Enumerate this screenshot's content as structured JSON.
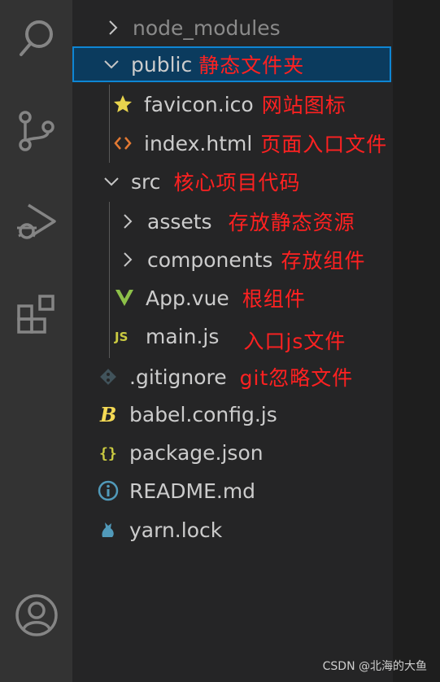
{
  "explorer": {
    "items": [
      {
        "name": "node_modules",
        "type": "folder",
        "expanded": false,
        "note": ""
      },
      {
        "name": "public",
        "type": "folder",
        "expanded": true,
        "note": "静态文件夹"
      },
      {
        "name": "favicon.ico",
        "type": "favicon",
        "note": "网站图标"
      },
      {
        "name": "index.html",
        "type": "html",
        "note": "页面入口文件"
      },
      {
        "name": "src",
        "type": "folder",
        "expanded": true,
        "note": "核心项目代码"
      },
      {
        "name": "assets",
        "type": "folder",
        "expanded": false,
        "note": "存放静态资源"
      },
      {
        "name": "components",
        "type": "folder",
        "expanded": false,
        "note": "存放组件"
      },
      {
        "name": "App.vue",
        "type": "vue",
        "note": "根组件"
      },
      {
        "name": "main.js",
        "type": "js",
        "note": "入口js文件"
      },
      {
        "name": ".gitignore",
        "type": "git",
        "note": "git忽略文件"
      },
      {
        "name": "babel.config.js",
        "type": "babel",
        "note": ""
      },
      {
        "name": "package.json",
        "type": "json",
        "note": ""
      },
      {
        "name": "README.md",
        "type": "info",
        "note": ""
      },
      {
        "name": "yarn.lock",
        "type": "yarn",
        "note": ""
      }
    ]
  },
  "icons": {
    "folder_chevron": "chevron-right-icon",
    "favicon": "star-icon",
    "html": "code-icon",
    "vue": "vue-icon",
    "js": "js-icon",
    "git": "git-icon",
    "babel": "babel-icon",
    "json": "braces-icon",
    "info": "info-icon",
    "yarn": "yarn-cat-icon"
  },
  "colors": {
    "selection_bg": "#0b3b5e",
    "selection_border": "#0e86d4",
    "annotation": "#ff2121",
    "favicon_star": "#e8d44d",
    "html_icon": "#e37933",
    "vue_icon": "#8dc149",
    "js_icon": "#cbcb41",
    "babel_icon": "#f5da55",
    "json_icon": "#cbcb41",
    "info_icon": "#519aba",
    "yarn_icon": "#519aba"
  },
  "watermark": "CSDN @北海的大鱼"
}
